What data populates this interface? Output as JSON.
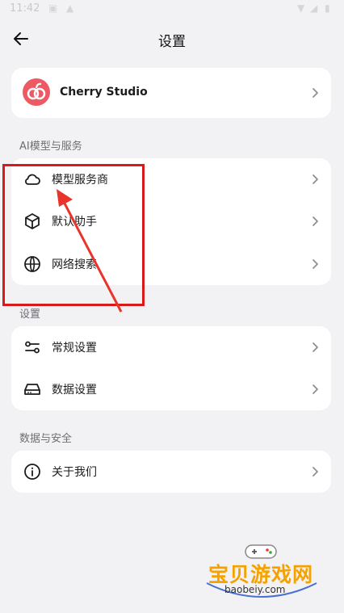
{
  "status_bar": {
    "time": "11:42"
  },
  "header": {
    "title": "设置"
  },
  "profile": {
    "name": "Cherry Studio"
  },
  "sections": [
    {
      "title": "AI模型与服务",
      "items": [
        {
          "label": "模型服务商",
          "icon": "cloud-icon"
        },
        {
          "label": "默认助手",
          "icon": "cube-icon"
        },
        {
          "label": "网络搜索",
          "icon": "globe-icon"
        }
      ]
    },
    {
      "title": "设置",
      "items": [
        {
          "label": "常规设置",
          "icon": "sliders-icon"
        },
        {
          "label": "数据设置",
          "icon": "hard-drive-icon"
        }
      ]
    },
    {
      "title": "数据与安全",
      "items": [
        {
          "label": "关于我们",
          "icon": "info-icon"
        }
      ]
    }
  ],
  "watermark": {
    "brand": "宝贝游戏网",
    "url": "baobeiy.com"
  },
  "colors": {
    "background": "#f2f2f4",
    "card": "#ffffff",
    "highlight": "#d91a1a",
    "logo": "#ec5b63",
    "watermark": "#f5a100"
  }
}
